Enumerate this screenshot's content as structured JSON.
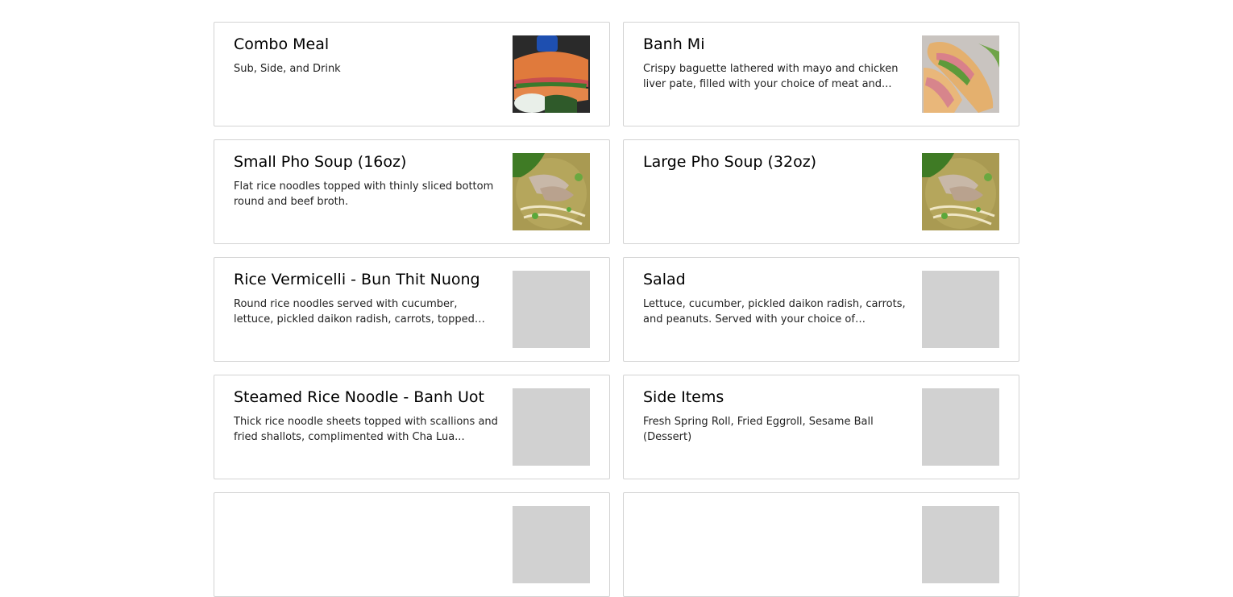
{
  "menu": {
    "items": [
      {
        "title": "Combo Meal",
        "description": "Sub, Side, and Drink",
        "image": "combo-meal-photo"
      },
      {
        "title": "Banh Mi",
        "description": "Crispy baguette lathered with mayo and chicken liver pate, filled with your choice of meat and...",
        "image": "banh-mi-photo"
      },
      {
        "title": "Small Pho Soup (16oz)",
        "description": "Flat rice noodles topped with thinly sliced bottom round and beef broth.",
        "image": "pho-soup-photo"
      },
      {
        "title": "Large Pho Soup (32oz)",
        "description": "",
        "image": "pho-soup-photo"
      },
      {
        "title": "Rice Vermicelli - Bun Thit Nuong",
        "description": "Round rice noodles served with cucumber, lettuce, pickled daikon radish, carrots, topped with an...",
        "image": "placeholder"
      },
      {
        "title": "Salad",
        "description": "Lettuce, cucumber, pickled daikon radish, carrots, and peanuts. Served with your choice of dressing...",
        "image": "placeholder"
      },
      {
        "title": "Steamed Rice Noodle - Banh Uot",
        "description": "Thick rice noodle sheets topped with scallions and fried shallots, complimented with Cha Lua...",
        "image": "placeholder"
      },
      {
        "title": "Side Items",
        "description": "Fresh Spring Roll, Fried Eggroll, Sesame Ball (Dessert)",
        "image": "placeholder"
      }
    ]
  },
  "colors": {
    "card_border": "#d3d3d3",
    "image_placeholder": "#d1d1d1"
  }
}
